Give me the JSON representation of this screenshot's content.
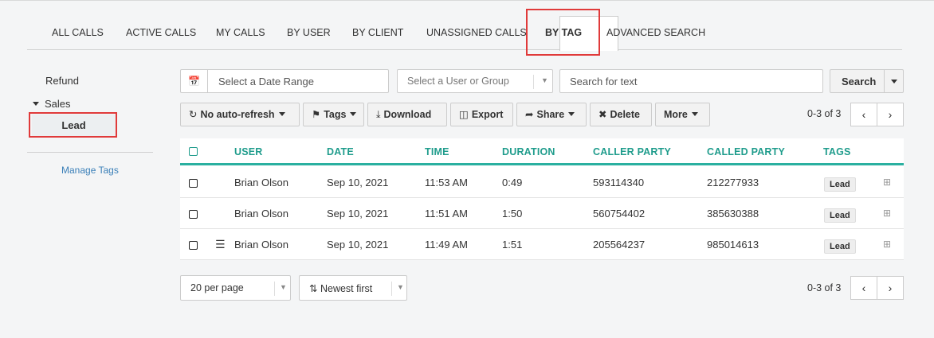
{
  "tabs": [
    {
      "label": "ALL CALLS"
    },
    {
      "label": "ACTIVE CALLS"
    },
    {
      "label": "MY CALLS"
    },
    {
      "label": "BY USER"
    },
    {
      "label": "BY CLIENT"
    },
    {
      "label": "UNASSIGNED CALLS"
    },
    {
      "label": "BY TAG",
      "active": true
    },
    {
      "label": "ADVANCED SEARCH"
    }
  ],
  "sidebar": {
    "items": [
      {
        "label": "Refund"
      },
      {
        "label": "Sales",
        "expanded": true,
        "children": [
          {
            "label": "Lead",
            "selected": true
          }
        ]
      }
    ],
    "manage_label": "Manage Tags"
  },
  "filters": {
    "date_placeholder": "Select a Date Range",
    "user_placeholder": "Select a User or Group",
    "search_placeholder": "Search for text",
    "search_label": "Search"
  },
  "toolbar": {
    "refresh_label": "No auto-refresh",
    "tags_label": "Tags",
    "download_label": "Download",
    "export_label": "Export",
    "share_label": "Share",
    "delete_label": "Delete",
    "more_label": "More"
  },
  "pager": {
    "range_text": "0-3 of 3"
  },
  "table": {
    "columns": [
      "USER",
      "DATE",
      "TIME",
      "DURATION",
      "CALLER PARTY",
      "CALLED PARTY",
      "TAGS"
    ],
    "rows": [
      {
        "user": "Brian Olson",
        "date": "Sep 10, 2021",
        "time": "11:53 AM",
        "duration": "0:49",
        "caller": "593114340",
        "called": "212277933",
        "tag": "Lead",
        "has_notes": false
      },
      {
        "user": "Brian Olson",
        "date": "Sep 10, 2021",
        "time": "11:51 AM",
        "duration": "1:50",
        "caller": "560754402",
        "called": "385630388",
        "tag": "Lead",
        "has_notes": false
      },
      {
        "user": "Brian Olson",
        "date": "Sep 10, 2021",
        "time": "11:49 AM",
        "duration": "1:51",
        "caller": "205564237",
        "called": "985014613",
        "tag": "Lead",
        "has_notes": true
      }
    ]
  },
  "footer": {
    "per_page": "20 per page",
    "sort": "Newest first"
  },
  "colors": {
    "accent": "#1f9c8c",
    "highlight": "#e03a3a"
  },
  "icons": {
    "calendar": "calendar-icon",
    "refresh": "refresh-icon",
    "tag": "tag-icon",
    "download": "download-icon",
    "export": "file-excel-icon",
    "share": "share-icon",
    "delete": "times-icon",
    "notes": "list-icon",
    "expand": "plus-square-icon",
    "sort": "sort-amount-icon"
  }
}
